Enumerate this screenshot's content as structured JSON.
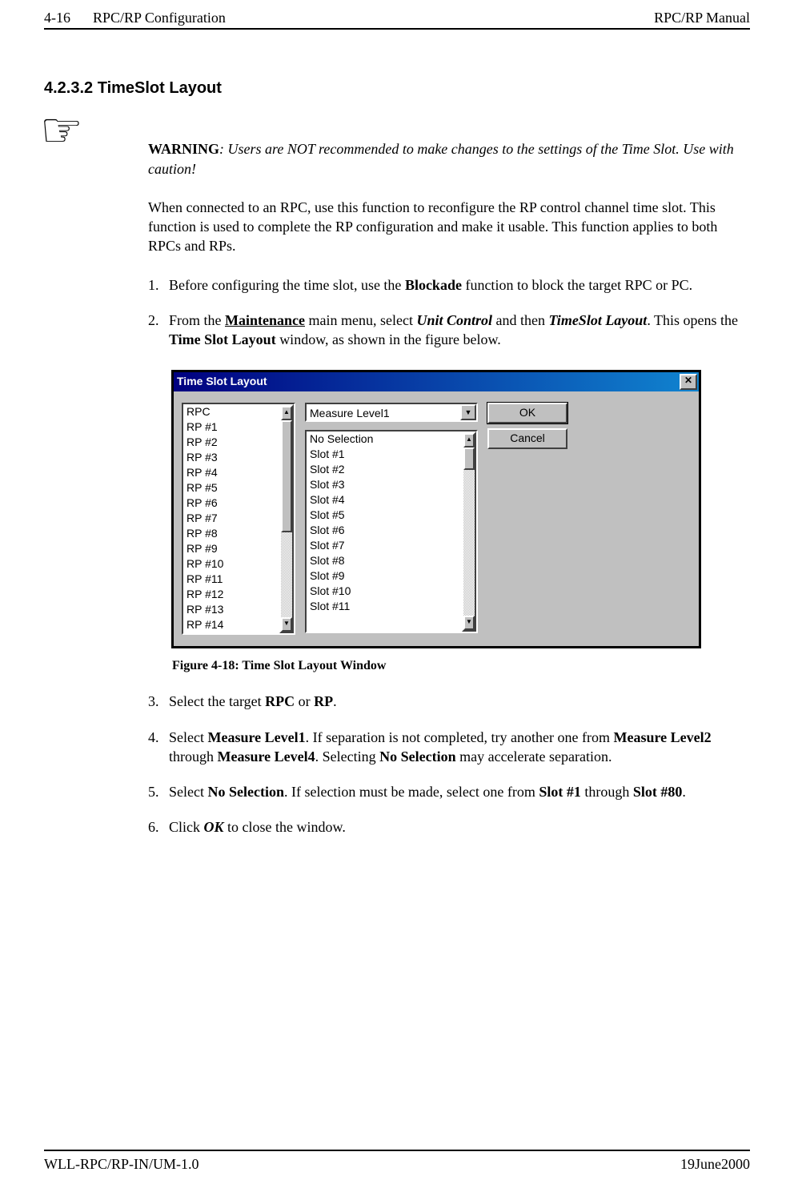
{
  "header": {
    "page": "4-16",
    "section": "RPC/RP Configuration",
    "right": "RPC/RP Manual"
  },
  "section_title": "4.2.3.2 TimeSlot Layout",
  "pointer_glyph": "☞",
  "warning": {
    "label": "WARNING",
    "text": ": Users are NOT recommended to make changes to the settings of the Time Slot.  Use with caution!"
  },
  "intro": "When connected to an RPC, use this function to reconfigure the RP control channel time slot.  This function is used to complete the RP configuration and make it usable.  This function applies to both RPCs and RPs.",
  "steps_a": [
    {
      "pre": "Before configuring the time slot, use the ",
      "b1": "Blockade",
      "post": " function to block the target RPC or PC."
    },
    {
      "pre": "From the ",
      "u1": "Maintenance",
      "mid1": " main menu, select ",
      "bi1": "Unit Control",
      "mid2": " and then ",
      "bi2": "TimeSlot Layout",
      "mid3": ".  This opens the ",
      "b2": "Time Slot Layout",
      "post": " window, as shown in the figure below."
    }
  ],
  "fig_caption": "Figure 4-18: Time Slot Layout Window",
  "steps_b": [
    {
      "n": "3.",
      "pre": "Select the target ",
      "b1": "RPC",
      "mid1": " or ",
      "b2": "RP",
      "post": "."
    },
    {
      "n": "4.",
      "pre": "Select ",
      "b1": "Measure Level1",
      "mid1": ".  If separation is not completed, try another one from ",
      "b2": "Measure Level2",
      "mid2": " through ",
      "b3": "Measure Level4",
      "mid3": ".  Selecting ",
      "b4": "No Selection",
      "post": " may accelerate separation."
    },
    {
      "n": "5.",
      "pre": "Select ",
      "b1": "No Selection",
      "mid1": ".  If selection must be made, select one from ",
      "b2": "Slot #1",
      "mid2": " through ",
      "b3": "Slot #80",
      "post": "."
    },
    {
      "n": "6.",
      "pre": "Click ",
      "bi1": "OK",
      "post": " to close the window."
    }
  ],
  "footer": {
    "left": "WLL-RPC/RP-IN/UM-1.0",
    "right": "19June2000"
  },
  "dialog": {
    "title": "Time Slot Layout",
    "close": "✕",
    "list1": [
      "RPC",
      "RP #1",
      "RP #2",
      "RP #3",
      "RP #4",
      "RP #5",
      "RP #6",
      "RP #7",
      "RP #8",
      "RP #9",
      "RP #10",
      "RP #11",
      "RP #12",
      "RP #13",
      "RP #14"
    ],
    "combo_value": "Measure Level1",
    "list2": [
      "No Selection",
      "Slot #1",
      "Slot #2",
      "Slot #3",
      "Slot #4",
      "Slot #5",
      "Slot #6",
      "Slot #7",
      "Slot #8",
      "Slot #9",
      "Slot #10",
      "Slot #11"
    ],
    "ok": "OK",
    "cancel": "Cancel",
    "arrow_up": "▲",
    "arrow_down": "▼"
  }
}
